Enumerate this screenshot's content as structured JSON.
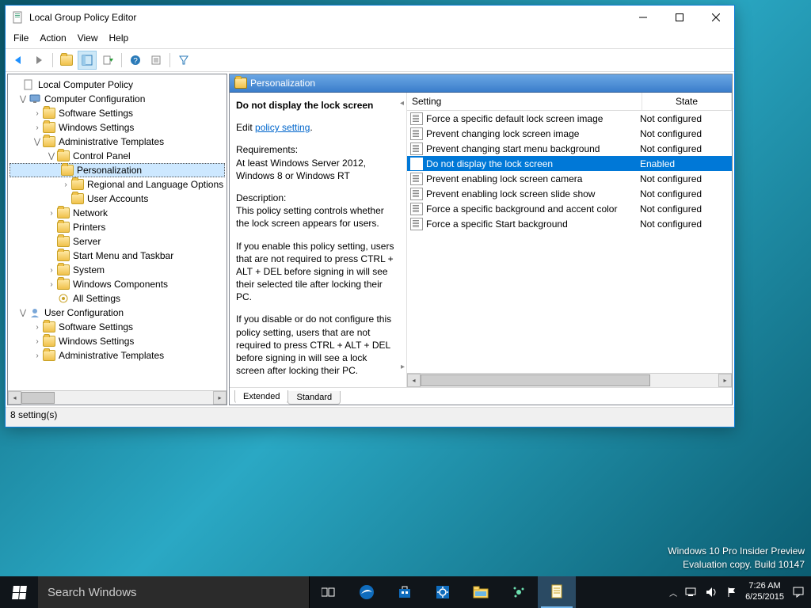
{
  "window": {
    "title": "Local Group Policy Editor",
    "menus": [
      "File",
      "Action",
      "View",
      "Help"
    ]
  },
  "tree": {
    "root": "Local Computer Policy",
    "cc": "Computer Configuration",
    "cc_items": [
      "Software Settings",
      "Windows Settings",
      "Administrative Templates"
    ],
    "cp": "Control Panel",
    "cp_items": [
      "Personalization",
      "Regional and Language Options",
      "User Accounts"
    ],
    "at_rest": [
      "Network",
      "Printers",
      "Server",
      "Start Menu and Taskbar",
      "System",
      "Windows Components",
      "All Settings"
    ],
    "uc": "User Configuration",
    "uc_items": [
      "Software Settings",
      "Windows Settings",
      "Administrative Templates"
    ]
  },
  "header": {
    "title": "Personalization"
  },
  "desc": {
    "policy_name": "Do not display the lock screen",
    "edit_prefix": "Edit ",
    "edit_link": "policy setting",
    "req_label": "Requirements:",
    "req_text": "At least Windows Server 2012, Windows 8 or Windows RT",
    "d_label": "Description:",
    "d1": "This policy setting controls whether the lock screen appears for users.",
    "d2": "If you enable this policy setting, users that are not required to press CTRL + ALT + DEL before signing in will see their selected tile after locking their PC.",
    "d3": "If you disable or do not configure this policy setting, users that are not required to press CTRL + ALT + DEL before signing in will see a lock screen after locking their PC."
  },
  "cols": {
    "c1": "Setting",
    "c2": "State"
  },
  "settings": [
    {
      "name": "Force a specific default lock screen image",
      "state": "Not configured",
      "sel": false
    },
    {
      "name": "Prevent changing lock screen image",
      "state": "Not configured",
      "sel": false
    },
    {
      "name": "Prevent changing start menu background",
      "state": "Not configured",
      "sel": false
    },
    {
      "name": "Do not display the lock screen",
      "state": "Enabled",
      "sel": true
    },
    {
      "name": "Prevent enabling lock screen camera",
      "state": "Not configured",
      "sel": false
    },
    {
      "name": "Prevent enabling lock screen slide show",
      "state": "Not configured",
      "sel": false
    },
    {
      "name": "Force a specific background and accent color",
      "state": "Not configured",
      "sel": false
    },
    {
      "name": "Force a specific Start background",
      "state": "Not configured",
      "sel": false
    }
  ],
  "tabs": {
    "extended": "Extended",
    "standard": "Standard"
  },
  "status": "8 setting(s)",
  "taskbar": {
    "search_placeholder": "Search Windows"
  },
  "watermark": {
    "l1": "Windows 10 Pro Insider Preview",
    "l2": "Evaluation copy. Build 10147"
  },
  "clock": {
    "time": "7:26 AM",
    "date": "6/25/2015"
  }
}
